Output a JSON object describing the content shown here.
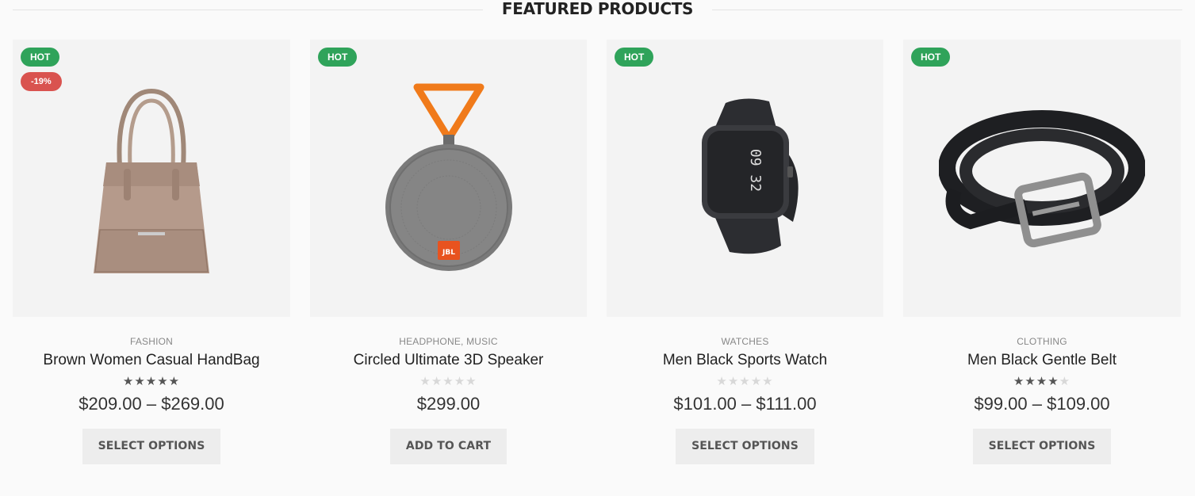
{
  "section": {
    "title": "FEATURED PRODUCTS"
  },
  "products": [
    {
      "badge_hot": "HOT",
      "badge_sale": "-19%",
      "category": "FASHION",
      "name": "Brown Women Casual HandBag",
      "rating": 5,
      "price": "$209.00 – $269.00",
      "button": "SELECT OPTIONS",
      "image_icon": "handbag-image"
    },
    {
      "badge_hot": "HOT",
      "category": "HEADPHONE, MUSIC",
      "name": "Circled Ultimate 3D Speaker",
      "rating": 0,
      "price": "$299.00",
      "button": "ADD TO CART",
      "image_icon": "speaker-image",
      "logo_text": "JBL"
    },
    {
      "badge_hot": "HOT",
      "category": "WATCHES",
      "name": "Men Black Sports Watch",
      "rating": 0,
      "price": "$101.00 – $111.00",
      "button": "SELECT OPTIONS",
      "image_icon": "smartwatch-image",
      "watch_time": "09 32"
    },
    {
      "badge_hot": "HOT",
      "category": "CLOTHING",
      "name": "Men Black Gentle Belt",
      "rating": 4,
      "price": "$99.00 – $109.00",
      "button": "SELECT OPTIONS",
      "image_icon": "belt-image"
    }
  ],
  "colors": {
    "hot_badge": "#2fa35a",
    "sale_badge": "#d9534f",
    "star_filled": "#555555",
    "star_empty": "#d8d8d8",
    "button_bg": "#ededed"
  }
}
